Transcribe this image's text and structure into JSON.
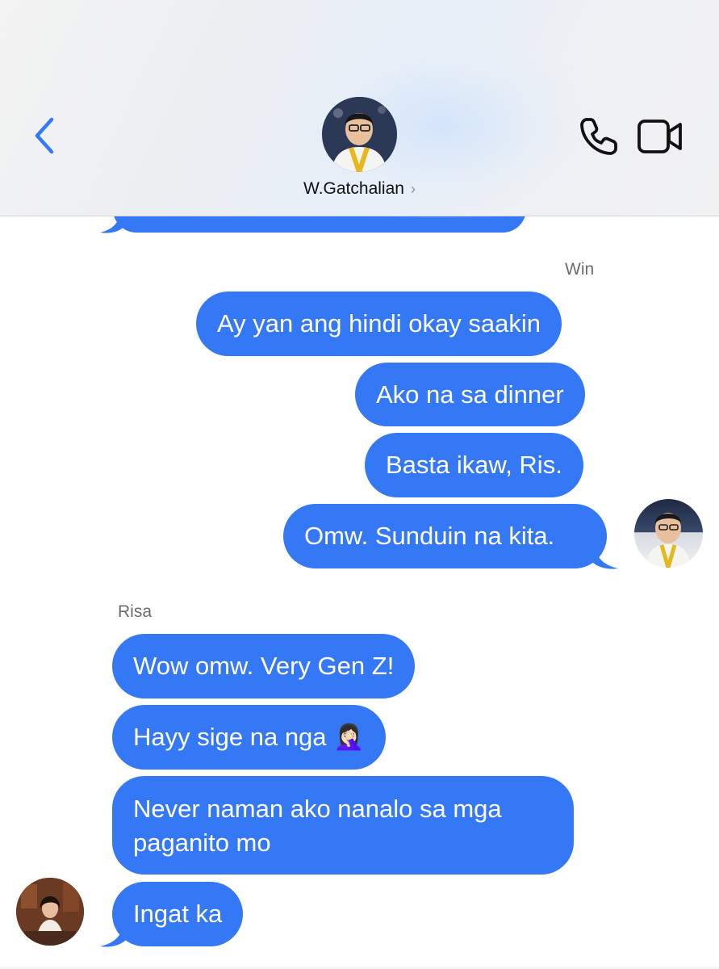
{
  "header": {
    "contact_name": "W.Gatchalian",
    "chevron": "›",
    "back_icon": "chevron-left-icon",
    "phone_icon": "phone-icon",
    "video_icon": "video-camera-icon",
    "accent_color": "#3478f6"
  },
  "messages": {
    "group_win": {
      "sender": "Win",
      "items": [
        "Ay yan ang hindi okay saakin",
        "Ako na sa dinner",
        "Basta ikaw, Ris.",
        "Omw. Sunduin na kita."
      ]
    },
    "group_risa": {
      "sender": "Risa",
      "items": [
        "Wow omw. Very Gen Z!",
        "Hayy sige na nga 🤦🏻‍♀️",
        "Never naman ako nanalo sa mga paganito mo",
        "Ingat ka"
      ]
    }
  }
}
